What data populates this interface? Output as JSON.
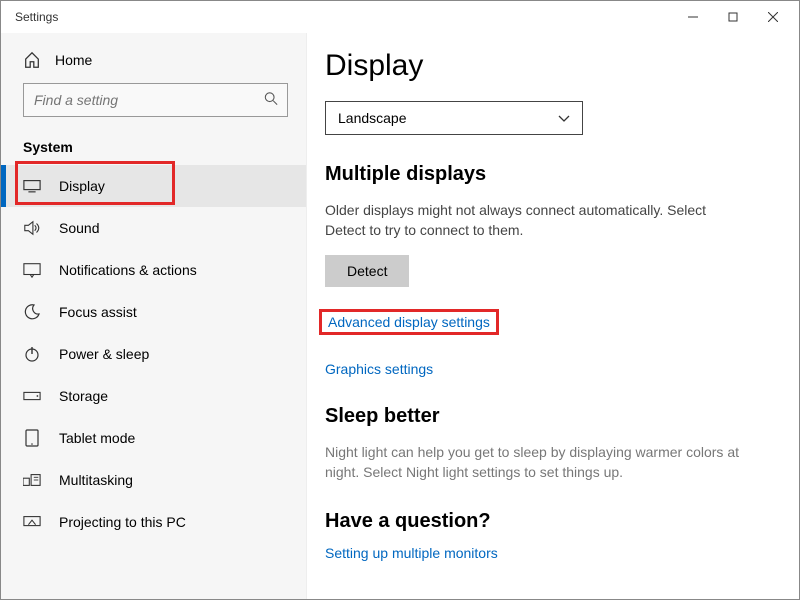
{
  "window": {
    "title": "Settings"
  },
  "sidebar": {
    "home_label": "Home",
    "search_placeholder": "Find a setting",
    "category_label": "System",
    "items": [
      {
        "label": "Display"
      },
      {
        "label": "Sound"
      },
      {
        "label": "Notifications & actions"
      },
      {
        "label": "Focus assist"
      },
      {
        "label": "Power & sleep"
      },
      {
        "label": "Storage"
      },
      {
        "label": "Tablet mode"
      },
      {
        "label": "Multitasking"
      },
      {
        "label": "Projecting to this PC"
      }
    ]
  },
  "main": {
    "title": "Display",
    "orientation_selected": "Landscape",
    "multiple_displays": {
      "heading": "Multiple displays",
      "text": "Older displays might not always connect automatically. Select Detect to try to connect to them.",
      "detect_label": "Detect",
      "advanced_link": "Advanced display settings",
      "graphics_link": "Graphics settings"
    },
    "sleep_better": {
      "heading": "Sleep better",
      "text": "Night light can help you get to sleep by displaying warmer colors at night. Select Night light settings to set things up."
    },
    "help": {
      "heading": "Have a question?",
      "link1": "Setting up multiple monitors"
    }
  }
}
